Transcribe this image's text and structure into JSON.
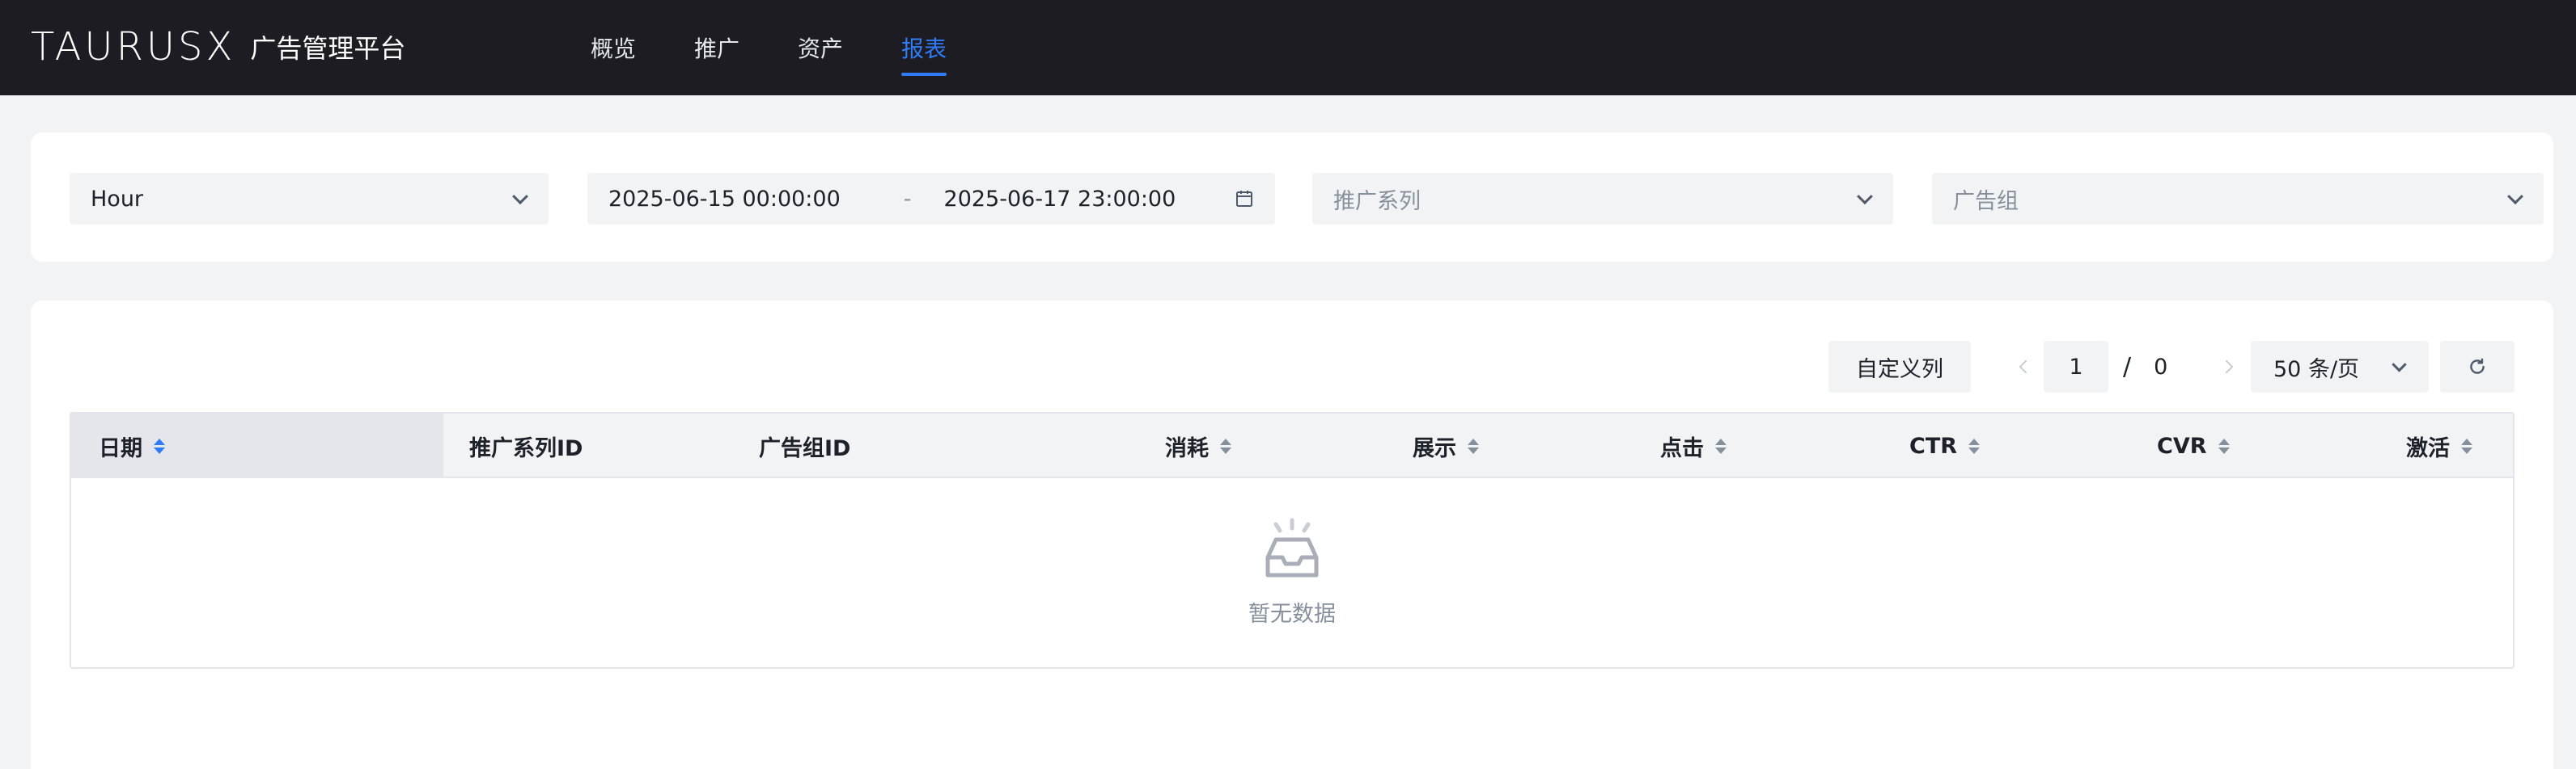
{
  "header": {
    "logo": "TAURUSX",
    "platform_name": "广告管理平台",
    "nav": [
      {
        "label": "概览",
        "active": false
      },
      {
        "label": "推广",
        "active": false
      },
      {
        "label": "资产",
        "active": false
      },
      {
        "label": "报表",
        "active": true
      }
    ]
  },
  "filters": {
    "granularity": "Hour",
    "date_start": "2025-06-15 00:00:00",
    "date_separator": "-",
    "date_end": "2025-06-17 23:00:00",
    "series_placeholder": "推广系列",
    "group_placeholder": "广告组"
  },
  "toolbar": {
    "custom_columns": "自定义列",
    "page_current": "1",
    "page_slash": "/",
    "page_total": "0",
    "page_size": "50 条/页"
  },
  "table": {
    "columns": [
      {
        "label": "日期",
        "sortable": true,
        "sorted": true
      },
      {
        "label": "推广系列ID",
        "sortable": false
      },
      {
        "label": "广告组ID",
        "sortable": false
      },
      {
        "label": "消耗",
        "sortable": true
      },
      {
        "label": "展示",
        "sortable": true
      },
      {
        "label": "点击",
        "sortable": true
      },
      {
        "label": "CTR",
        "sortable": true
      },
      {
        "label": "CVR",
        "sortable": true
      },
      {
        "label": "激活",
        "sortable": true
      }
    ],
    "empty_text": "暂无数据"
  },
  "colors": {
    "accent": "#2f7cf6",
    "topbar": "#1c1c22"
  }
}
